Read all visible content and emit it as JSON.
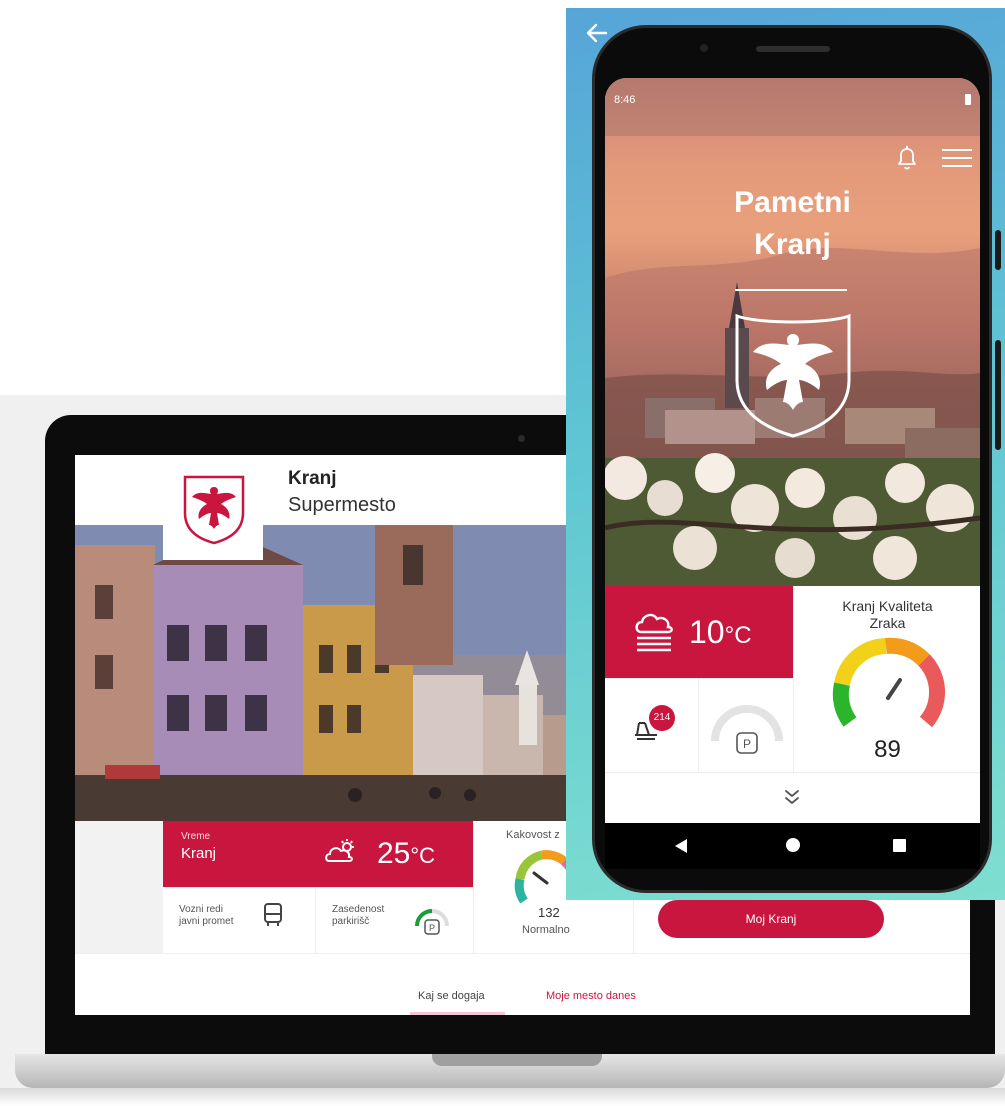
{
  "laptop": {
    "header": {
      "title": "Kranj",
      "subtitle": "Supermesto"
    },
    "weather": {
      "label": "Vreme",
      "city": "Kranj",
      "temp": "25",
      "unit": "°C"
    },
    "air_quality": {
      "title": "Kakovost z",
      "value": "132",
      "status": "Normalno"
    },
    "tiles": {
      "transit_line1": "Vozni redi",
      "transit_line2": "javni promet",
      "parking_line1": "Zasedenost",
      "parking_line2": "parkirišč",
      "parking_symbol": "P"
    },
    "cta_button": "Moj Kranj",
    "nav": {
      "tab1": "Kaj se dogaja",
      "tab2": "Moje mesto danes"
    }
  },
  "phone": {
    "status": {
      "time": "8:46"
    },
    "title_line1": "Pametni",
    "title_line2": "Kranj",
    "weather": {
      "temp": "10",
      "unit": "°C"
    },
    "air_quality": {
      "title_line1": "Kranj Kvaliteta",
      "title_line2": "Zraka",
      "value": "89"
    },
    "transit_badge": "214",
    "parking_symbol": "P"
  },
  "colors": {
    "accent": "#c8163f",
    "gauge_green": "#2bb52b",
    "gauge_yellow": "#f2d11b",
    "gauge_orange": "#f39b1a",
    "gauge_red": "#ea5a5a",
    "phone_bg": "#5fc5d3"
  },
  "icons": [
    "back-arrow-icon",
    "bell-icon",
    "menu-icon",
    "cloud-sun-icon",
    "fog-cloud-icon",
    "bus-icon",
    "parking-icon",
    "gauge-icon",
    "chevron-double-down-icon",
    "crest-icon"
  ]
}
